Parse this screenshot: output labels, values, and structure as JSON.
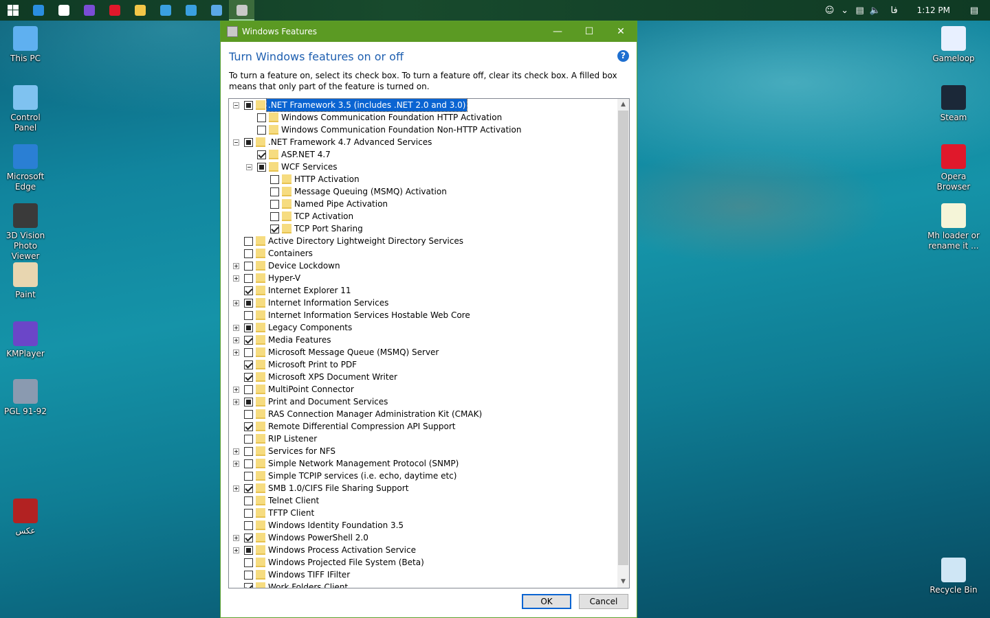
{
  "taskbar": {
    "apps": [
      {
        "name": "start",
        "color": "#ffffff"
      },
      {
        "name": "edge",
        "color": "#2a8ee0"
      },
      {
        "name": "mail",
        "color": "#ffffff"
      },
      {
        "name": "kmplayer",
        "color": "#7a4dd6"
      },
      {
        "name": "opera",
        "color": "#e0182b"
      },
      {
        "name": "file-explorer",
        "color": "#f2c648"
      },
      {
        "name": "app-blue-1",
        "color": "#3aa0e0"
      },
      {
        "name": "app-blue-2",
        "color": "#3aa0e0"
      },
      {
        "name": "control-panel",
        "color": "#5aa8e6"
      },
      {
        "name": "windows-features",
        "color": "#c9c9c9"
      }
    ],
    "tray": {
      "language": "فا",
      "time": "1:12 PM"
    }
  },
  "desktop": {
    "left_icons": [
      {
        "label": "This PC",
        "icon": "computer-icon",
        "color": "#5fb0f0"
      },
      {
        "label": "Control Panel",
        "icon": "control-panel-icon",
        "color": "#7fc2f0"
      },
      {
        "label": "Microsoft Edge",
        "icon": "edge-icon",
        "color": "#2a7fd4"
      },
      {
        "label": "3D Vision Photo Viewer",
        "icon": "nvidia-3d-vision-icon",
        "color": "#3a3a3a"
      },
      {
        "label": "Paint",
        "icon": "paint-icon",
        "color": "#e8d6b0"
      },
      {
        "label": "KMPlayer",
        "icon": "kmplayer-icon",
        "color": "#6b46c8"
      },
      {
        "label": "PGL 91-92",
        "icon": "pgl-game-icon",
        "color": "#8a9ab0"
      },
      {
        "label": "عکس",
        "icon": "photo-folder-icon",
        "color": "#b22222"
      }
    ],
    "right_icons": [
      {
        "label": "Gameloop",
        "icon": "gameloop-icon",
        "color": "#e8f0ff"
      },
      {
        "label": "Steam",
        "icon": "steam-icon",
        "color": "#1b2838"
      },
      {
        "label": "Opera Browser",
        "icon": "opera-icon",
        "color": "#e0182b"
      },
      {
        "label": "Mh loader or rename it ...",
        "icon": "file-icon",
        "color": "#f5f5d8"
      },
      {
        "label": "Recycle Bin",
        "icon": "recycle-bin-icon",
        "color": "#cfe6f5"
      }
    ]
  },
  "window": {
    "title": "Windows Features",
    "heading": "Turn Windows features on or off",
    "description": "To turn a feature on, select its check box. To turn a feature off, clear its check box. A filled box means that only part of the feature is turned on.",
    "help": "?",
    "features": [
      {
        "label": ".NET Framework 3.5 (includes .NET 2.0 and 3.0)",
        "level": 0,
        "expander": "minus",
        "state": "partial",
        "selected": true
      },
      {
        "label": "Windows Communication Foundation HTTP Activation",
        "level": 1,
        "expander": "none",
        "state": "unchecked"
      },
      {
        "label": "Windows Communication Foundation Non-HTTP Activation",
        "level": 1,
        "expander": "none",
        "state": "unchecked"
      },
      {
        "label": ".NET Framework 4.7 Advanced Services",
        "level": 0,
        "expander": "minus",
        "state": "partial"
      },
      {
        "label": "ASP.NET 4.7",
        "level": 1,
        "expander": "none",
        "state": "checked"
      },
      {
        "label": "WCF Services",
        "level": 1,
        "expander": "minus",
        "state": "partial"
      },
      {
        "label": "HTTP Activation",
        "level": 2,
        "expander": "none",
        "state": "unchecked"
      },
      {
        "label": "Message Queuing (MSMQ) Activation",
        "level": 2,
        "expander": "none",
        "state": "unchecked"
      },
      {
        "label": "Named Pipe Activation",
        "level": 2,
        "expander": "none",
        "state": "unchecked"
      },
      {
        "label": "TCP Activation",
        "level": 2,
        "expander": "none",
        "state": "unchecked"
      },
      {
        "label": "TCP Port Sharing",
        "level": 2,
        "expander": "none",
        "state": "checked"
      },
      {
        "label": "Active Directory Lightweight Directory Services",
        "level": 0,
        "expander": "none",
        "state": "unchecked"
      },
      {
        "label": "Containers",
        "level": 0,
        "expander": "none",
        "state": "unchecked"
      },
      {
        "label": "Device Lockdown",
        "level": 0,
        "expander": "plus",
        "state": "unchecked"
      },
      {
        "label": "Hyper-V",
        "level": 0,
        "expander": "plus",
        "state": "unchecked"
      },
      {
        "label": "Internet Explorer 11",
        "level": 0,
        "expander": "none",
        "state": "checked"
      },
      {
        "label": "Internet Information Services",
        "level": 0,
        "expander": "plus",
        "state": "partial"
      },
      {
        "label": "Internet Information Services Hostable Web Core",
        "level": 0,
        "expander": "none",
        "state": "unchecked"
      },
      {
        "label": "Legacy Components",
        "level": 0,
        "expander": "plus",
        "state": "partial"
      },
      {
        "label": "Media Features",
        "level": 0,
        "expander": "plus",
        "state": "checked"
      },
      {
        "label": "Microsoft Message Queue (MSMQ) Server",
        "level": 0,
        "expander": "plus",
        "state": "unchecked"
      },
      {
        "label": "Microsoft Print to PDF",
        "level": 0,
        "expander": "none",
        "state": "checked"
      },
      {
        "label": "Microsoft XPS Document Writer",
        "level": 0,
        "expander": "none",
        "state": "checked"
      },
      {
        "label": "MultiPoint Connector",
        "level": 0,
        "expander": "plus",
        "state": "unchecked"
      },
      {
        "label": "Print and Document Services",
        "level": 0,
        "expander": "plus",
        "state": "partial"
      },
      {
        "label": "RAS Connection Manager Administration Kit (CMAK)",
        "level": 0,
        "expander": "none",
        "state": "unchecked"
      },
      {
        "label": "Remote Differential Compression API Support",
        "level": 0,
        "expander": "none",
        "state": "checked"
      },
      {
        "label": "RIP Listener",
        "level": 0,
        "expander": "none",
        "state": "unchecked"
      },
      {
        "label": "Services for NFS",
        "level": 0,
        "expander": "plus",
        "state": "unchecked"
      },
      {
        "label": "Simple Network Management Protocol (SNMP)",
        "level": 0,
        "expander": "plus",
        "state": "unchecked"
      },
      {
        "label": "Simple TCPIP services (i.e. echo, daytime etc)",
        "level": 0,
        "expander": "none",
        "state": "unchecked"
      },
      {
        "label": "SMB 1.0/CIFS File Sharing Support",
        "level": 0,
        "expander": "plus",
        "state": "checked"
      },
      {
        "label": "Telnet Client",
        "level": 0,
        "expander": "none",
        "state": "unchecked"
      },
      {
        "label": "TFTP Client",
        "level": 0,
        "expander": "none",
        "state": "unchecked"
      },
      {
        "label": "Windows Identity Foundation 3.5",
        "level": 0,
        "expander": "none",
        "state": "unchecked"
      },
      {
        "label": "Windows PowerShell 2.0",
        "level": 0,
        "expander": "plus",
        "state": "checked"
      },
      {
        "label": "Windows Process Activation Service",
        "level": 0,
        "expander": "plus",
        "state": "partial"
      },
      {
        "label": "Windows Projected File System (Beta)",
        "level": 0,
        "expander": "none",
        "state": "unchecked"
      },
      {
        "label": "Windows TIFF IFilter",
        "level": 0,
        "expander": "none",
        "state": "unchecked"
      },
      {
        "label": "Work Folders Client",
        "level": 0,
        "expander": "none",
        "state": "checked"
      }
    ],
    "ok_label": "OK",
    "cancel_label": "Cancel"
  }
}
